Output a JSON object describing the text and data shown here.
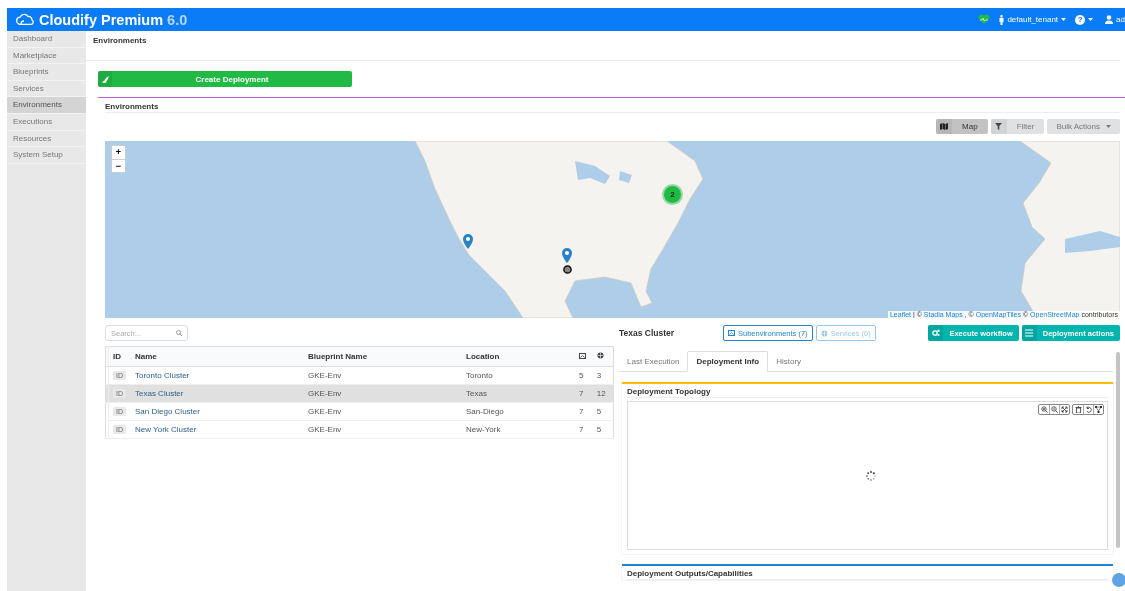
{
  "header": {
    "brand": "Cloudify Premium",
    "version": "6.0",
    "tenant": "default_tenant",
    "help": "?",
    "user": "ad"
  },
  "sidebar": {
    "items": [
      {
        "label": "Dashboard",
        "selected": false
      },
      {
        "label": "Marketplace",
        "selected": false
      },
      {
        "label": "Blueprints",
        "selected": false
      },
      {
        "label": "Services",
        "selected": false
      },
      {
        "label": "Environments",
        "selected": true
      },
      {
        "label": "Executions",
        "selected": false
      },
      {
        "label": "Resources",
        "selected": false
      },
      {
        "label": "System Setup",
        "selected": false
      }
    ]
  },
  "breadcrumb": "Environments",
  "create_button": "Create Deployment",
  "widget": {
    "title": "Environments",
    "views": [
      {
        "label": "Map",
        "kind": "map",
        "selected": true
      },
      {
        "label": "Filter",
        "kind": "filter",
        "selected": false
      }
    ],
    "bulk_actions": "Bulk Actions"
  },
  "map": {
    "zoom_in": "+",
    "zoom_out": "−",
    "cluster_count": "2",
    "attribution": [
      {
        "text": "Leaflet",
        "link": true
      },
      {
        "text": "| ©",
        "link": false
      },
      {
        "text": "Stadia Maps",
        "link": true
      },
      {
        "text": ", ©",
        "link": false
      },
      {
        "text": "OpenMapTiles",
        "link": true
      },
      {
        "text": "©",
        "link": false
      },
      {
        "text": "OpenStreetMap",
        "link": true
      },
      {
        "text": "contributors",
        "link": false
      }
    ]
  },
  "search": {
    "placeholder": "Search..."
  },
  "table": {
    "columns": [
      "ID",
      "Name",
      "Blueprint Name",
      "Location"
    ],
    "rows": [
      {
        "id": "ID",
        "name": "Toronto Cluster",
        "blueprint": "GKE-Env",
        "location": "Toronto",
        "subenvironments": "5",
        "services": "3",
        "selected": false
      },
      {
        "id": "ID",
        "name": "Texas Cluster",
        "blueprint": "GKE-Env",
        "location": "Texas",
        "subenvironments": "7",
        "services": "12",
        "selected": true
      },
      {
        "id": "ID",
        "name": "San Diego Cluster",
        "blueprint": "GKE-Env",
        "location": "San-Diego",
        "subenvironments": "7",
        "services": "5",
        "selected": false
      },
      {
        "id": "ID",
        "name": "New York Cluster",
        "blueprint": "GKE-Env",
        "location": "New-York",
        "subenvironments": "7",
        "services": "5",
        "selected": false
      }
    ]
  },
  "details": {
    "title": "Texas Cluster",
    "subenvironments_button": {
      "label": "Subenvironments (7)",
      "disabled": false
    },
    "services_button": {
      "label": "Services (0)",
      "disabled": true
    },
    "actions": [
      {
        "label": "Execute workflow",
        "kind": "workflow"
      },
      {
        "label": "Deployment actions",
        "kind": "menu"
      }
    ],
    "tabs": [
      {
        "label": "Last Execution",
        "selected": false
      },
      {
        "label": "Deployment Info",
        "selected": true
      },
      {
        "label": "History",
        "selected": false
      }
    ],
    "sections": [
      {
        "title": "Deployment Topology",
        "kind": "topology",
        "color": "#fbbd08"
      },
      {
        "title": "Deployment Outputs/Capabilities",
        "kind": "outputs",
        "color": "#2185d0"
      }
    ]
  }
}
